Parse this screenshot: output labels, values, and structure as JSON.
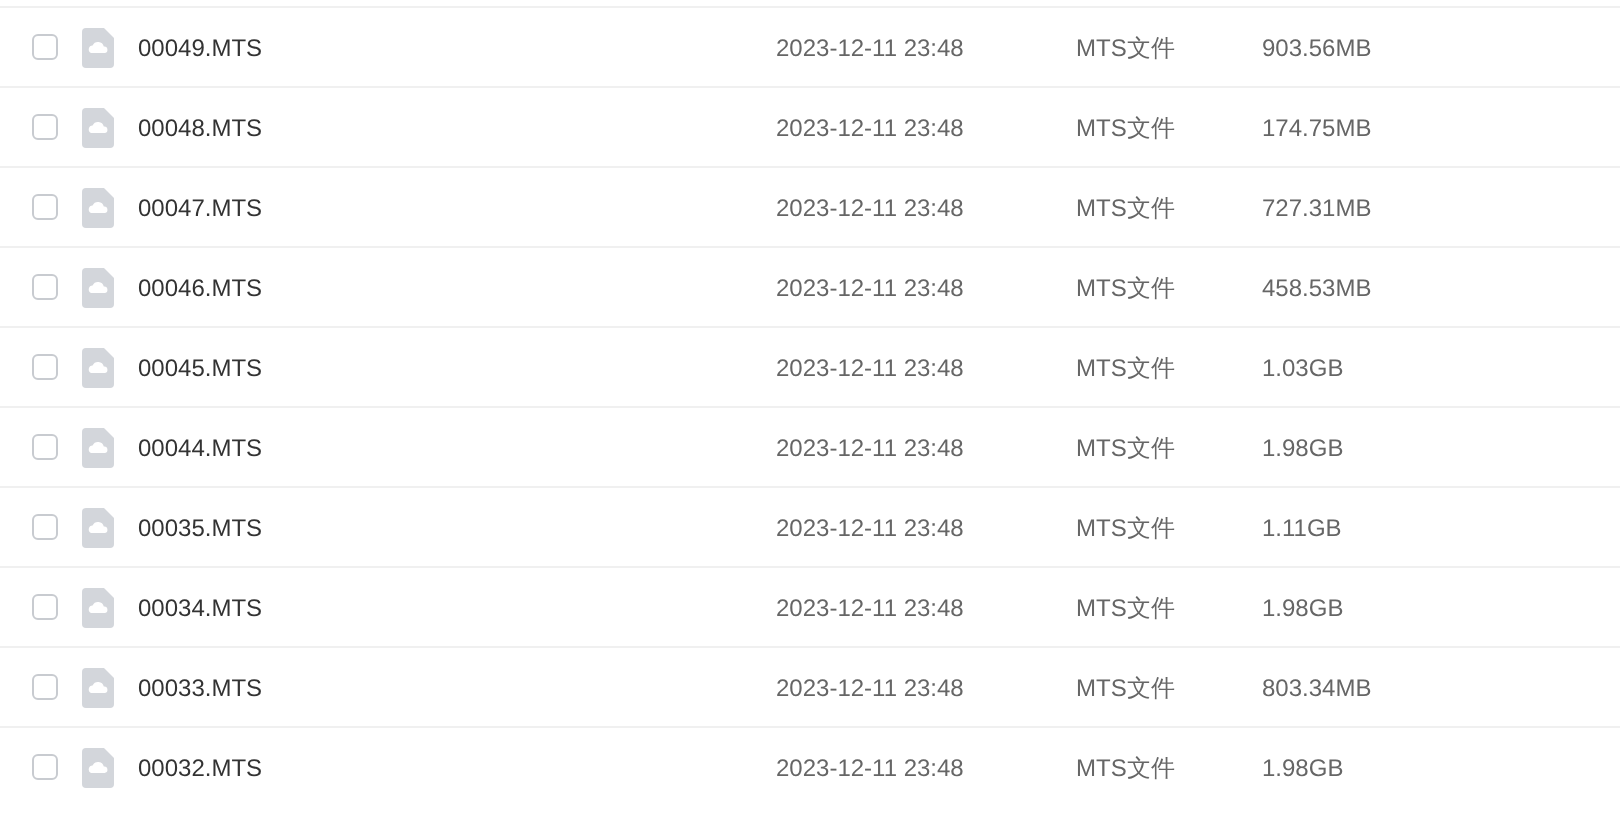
{
  "files": [
    {
      "name": "00049.MTS",
      "modified": "2023-12-11 23:48",
      "type": "MTS文件",
      "size": "903.56MB",
      "checked": false
    },
    {
      "name": "00048.MTS",
      "modified": "2023-12-11 23:48",
      "type": "MTS文件",
      "size": "174.75MB",
      "checked": false
    },
    {
      "name": "00047.MTS",
      "modified": "2023-12-11 23:48",
      "type": "MTS文件",
      "size": "727.31MB",
      "checked": false
    },
    {
      "name": "00046.MTS",
      "modified": "2023-12-11 23:48",
      "type": "MTS文件",
      "size": "458.53MB",
      "checked": false
    },
    {
      "name": "00045.MTS",
      "modified": "2023-12-11 23:48",
      "type": "MTS文件",
      "size": "1.03GB",
      "checked": false
    },
    {
      "name": "00044.MTS",
      "modified": "2023-12-11 23:48",
      "type": "MTS文件",
      "size": "1.98GB",
      "checked": false
    },
    {
      "name": "00035.MTS",
      "modified": "2023-12-11 23:48",
      "type": "MTS文件",
      "size": "1.11GB",
      "checked": false
    },
    {
      "name": "00034.MTS",
      "modified": "2023-12-11 23:48",
      "type": "MTS文件",
      "size": "1.98GB",
      "checked": false
    },
    {
      "name": "00033.MTS",
      "modified": "2023-12-11 23:48",
      "type": "MTS文件",
      "size": "803.34MB",
      "checked": false
    },
    {
      "name": "00032.MTS",
      "modified": "2023-12-11 23:48",
      "type": "MTS文件",
      "size": "1.98GB",
      "checked": false
    }
  ]
}
